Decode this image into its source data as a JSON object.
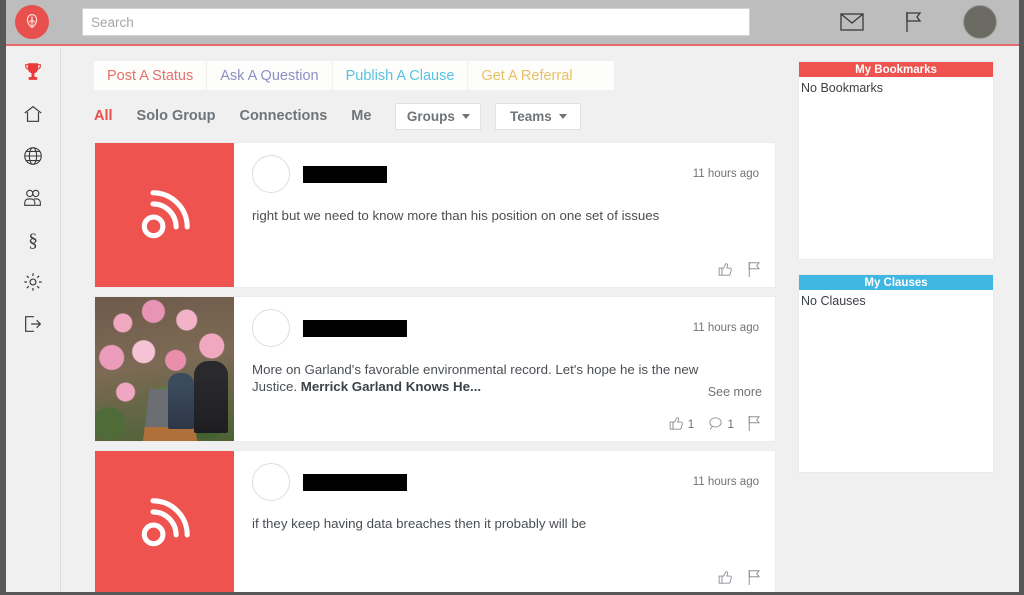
{
  "header": {
    "logo_icon": "tulip-logo-icon",
    "search": {
      "placeholder": "Search",
      "value": ""
    },
    "mail_icon": "envelope-icon",
    "flag_icon": "flag-icon",
    "avatar": "user-avatar"
  },
  "rail": {
    "items": [
      {
        "icon": "trophy-icon",
        "name": "sidebar-item-trophy"
      },
      {
        "icon": "home-icon",
        "name": "sidebar-item-home"
      },
      {
        "icon": "globe-icon",
        "name": "sidebar-item-globe"
      },
      {
        "icon": "users-icon",
        "name": "sidebar-item-users"
      },
      {
        "icon": "section-sign-icon",
        "name": "sidebar-item-clauses"
      },
      {
        "icon": "gear-icon",
        "name": "sidebar-item-settings"
      },
      {
        "icon": "logout-icon",
        "name": "sidebar-item-logout"
      }
    ]
  },
  "action_tabs": [
    {
      "label": "Post A Status",
      "color": "#e2726c"
    },
    {
      "label": "Ask A Question",
      "color": "#8d8fc4"
    },
    {
      "label": "Publish A Clause",
      "color": "#57c3e4"
    },
    {
      "label": "Get A Referral",
      "color": "#e8c166"
    }
  ],
  "filters": {
    "links": [
      {
        "label": "All",
        "active": true
      },
      {
        "label": "Solo Group",
        "active": false
      },
      {
        "label": "Connections",
        "active": false
      },
      {
        "label": "Me",
        "active": false
      }
    ],
    "dropdowns": [
      {
        "label": "Groups"
      },
      {
        "label": "Teams"
      }
    ]
  },
  "feed": {
    "posts": [
      {
        "thumb_type": "rss",
        "avatar_type": "female",
        "author_redacted_width": 84,
        "time": "11 hours ago",
        "text": "right but we need to know more than his position on one set of issues",
        "bold_text": "",
        "see_more": "",
        "like_count": "",
        "comment_count": "",
        "has_comment": false
      },
      {
        "thumb_type": "photo",
        "avatar_type": "male",
        "author_redacted_width": 104,
        "time": "11 hours ago",
        "text": "More on Garland's favorable environmental record. Let's hope he is the new Justice. ",
        "bold_text": "Merrick Garland Knows He...",
        "see_more": "See more",
        "like_count": "1",
        "comment_count": "1",
        "has_comment": true
      },
      {
        "thumb_type": "rss",
        "avatar_type": "male",
        "author_redacted_width": 104,
        "time": "11 hours ago",
        "text": "if they keep having data breaches then it probably will be",
        "bold_text": "",
        "see_more": "",
        "like_count": "",
        "comment_count": "",
        "has_comment": false
      }
    ]
  },
  "right_panels": [
    {
      "title": "My Bookmarks",
      "empty_text": "No Bookmarks",
      "accent": "#ef5350"
    },
    {
      "title": "My Clauses",
      "empty_text": "No Clauses",
      "accent": "#3fb7e2"
    }
  ]
}
